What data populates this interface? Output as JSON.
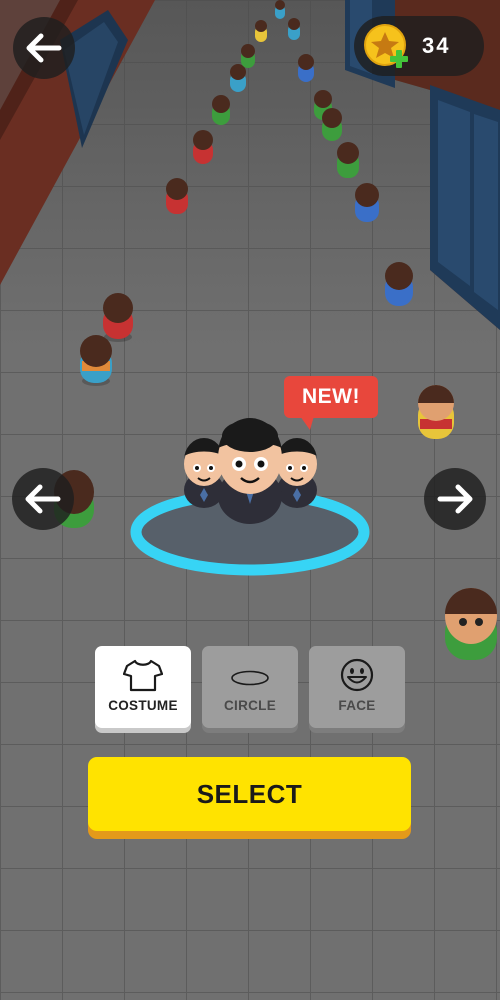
{
  "header": {
    "back_icon": "arrow-left-icon",
    "coins": {
      "icon": "star-coin-icon",
      "add_icon": "plus-icon",
      "count": "34"
    }
  },
  "preview": {
    "badge": "NEW!",
    "prev_icon": "arrow-left-icon",
    "next_icon": "arrow-right-icon"
  },
  "tabs": [
    {
      "label": "COSTUME",
      "icon": "shirt-icon",
      "active": true
    },
    {
      "label": "CIRCLE",
      "icon": "ellipse-icon",
      "active": false
    },
    {
      "label": "FACE",
      "icon": "smiley-icon",
      "active": false
    }
  ],
  "actions": {
    "select_label": "SELECT"
  },
  "colors": {
    "accent_yellow": "#ffe300",
    "badge_red": "#e8473c",
    "coin_gold": "#f6c21c",
    "plus_green": "#43c43a",
    "circle_cyan": "#37d4f5"
  }
}
